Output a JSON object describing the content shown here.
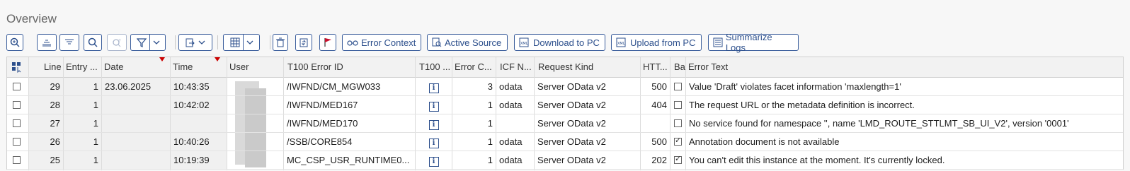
{
  "title": "Overview",
  "toolbar": {
    "buttons": [
      {
        "label": "Error Context",
        "icon": "glasses-icon"
      },
      {
        "label": "Active Source",
        "icon": "source-search-icon"
      },
      {
        "label": "Download to PC",
        "icon": "xml-download-icon"
      },
      {
        "label": "Upload from PC",
        "icon": "xml-upload-icon"
      },
      {
        "label": "Summarize Logs",
        "icon": "list-summary-icon"
      }
    ]
  },
  "table": {
    "columns": [
      "Line",
      "Entry ...",
      "Date",
      "Time",
      "User",
      "T100 Error ID",
      "T100 ...",
      "Error C...",
      "ICF N...",
      "Request Kind",
      "HTT...",
      "Ba",
      "Error Text"
    ],
    "rows": [
      {
        "line": "29",
        "entry": "1",
        "date": "23.06.2025",
        "time": "10:43:35",
        "error_id": "/IWFND/CM_MGW033",
        "error_count": "3",
        "icf": "odata",
        "kind": "Server OData v2",
        "http": "500",
        "ba": false,
        "text": "Value 'Draft' violates facet information 'maxlength=1'"
      },
      {
        "line": "28",
        "entry": "1",
        "date": "",
        "time": "10:42:02",
        "error_id": "/IWFND/MED167",
        "error_count": "1",
        "icf": "odata",
        "kind": "Server OData v2",
        "http": "404",
        "ba": false,
        "text": "The request URL or the metadata definition is incorrect."
      },
      {
        "line": "27",
        "entry": "1",
        "date": "",
        "time": "",
        "error_id": "/IWFND/MED170",
        "error_count": "1",
        "icf": "",
        "kind": "Server OData v2",
        "http": "",
        "ba": false,
        "text": "No service found for namespace '', name 'LMD_ROUTE_STTLMT_SB_UI_V2', version '0001'"
      },
      {
        "line": "26",
        "entry": "1",
        "date": "",
        "time": "10:40:26",
        "error_id": "/SSB/CORE854",
        "error_count": "1",
        "icf": "odata",
        "kind": "Server OData v2",
        "http": "500",
        "ba": true,
        "text": "Annotation document is not available"
      },
      {
        "line": "25",
        "entry": "1",
        "date": "",
        "time": "10:19:39",
        "error_id": "MC_CSP_USR_RUNTIME0...",
        "error_count": "1",
        "icf": "odata",
        "kind": "Server OData v2",
        "http": "202",
        "ba": true,
        "text": "You can't edit this instance at the moment. It's currently locked."
      }
    ]
  }
}
